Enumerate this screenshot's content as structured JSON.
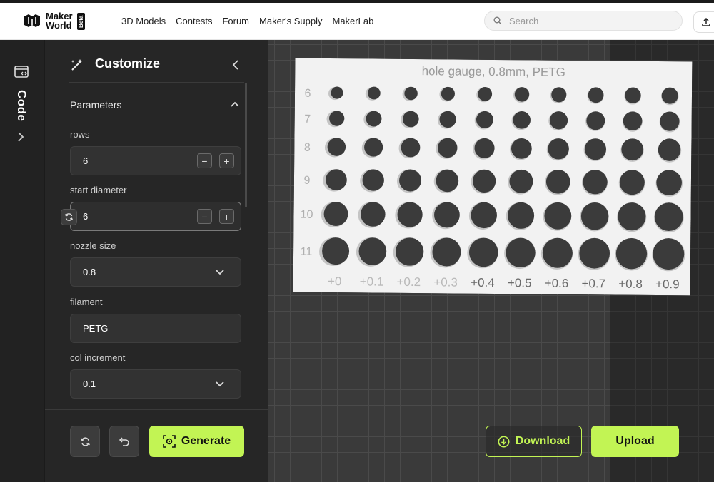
{
  "topbar": {
    "logo_line1": "Maker",
    "logo_line2": "World",
    "beta": "Beta",
    "nav": [
      "3D Models",
      "Contests",
      "Forum",
      "Maker's Supply",
      "MakerLab"
    ],
    "search_placeholder": "Search"
  },
  "rail": {
    "code_label": "Code"
  },
  "panel": {
    "title": "Customize",
    "section": "Parameters",
    "fields": {
      "rows": {
        "label": "rows",
        "value": "6"
      },
      "start_diameter": {
        "label": "start diameter",
        "value": "6"
      },
      "nozzle_size": {
        "label": "nozzle size",
        "value": "0.8"
      },
      "filament": {
        "label": "filament",
        "value": "PETG"
      },
      "col_increment": {
        "label": "col increment",
        "value": "0.1"
      }
    },
    "generate_label": "Generate"
  },
  "preview": {
    "plate_title": "hole gauge, 0.8mm, PETG",
    "row_labels": [
      "6",
      "7",
      "8",
      "9",
      "10",
      "11"
    ],
    "col_labels": [
      "+0",
      "+0.1",
      "+0.2",
      "+0.3",
      "+0.4",
      "+0.5",
      "+0.6",
      "+0.7",
      "+0.8",
      "+0.9"
    ]
  },
  "actions": {
    "download_label": "Download",
    "upload_label": "Upload"
  },
  "colors": {
    "accent": "#c2f454",
    "panel_bg": "#262626",
    "topbar_bg": "#ffffff"
  }
}
